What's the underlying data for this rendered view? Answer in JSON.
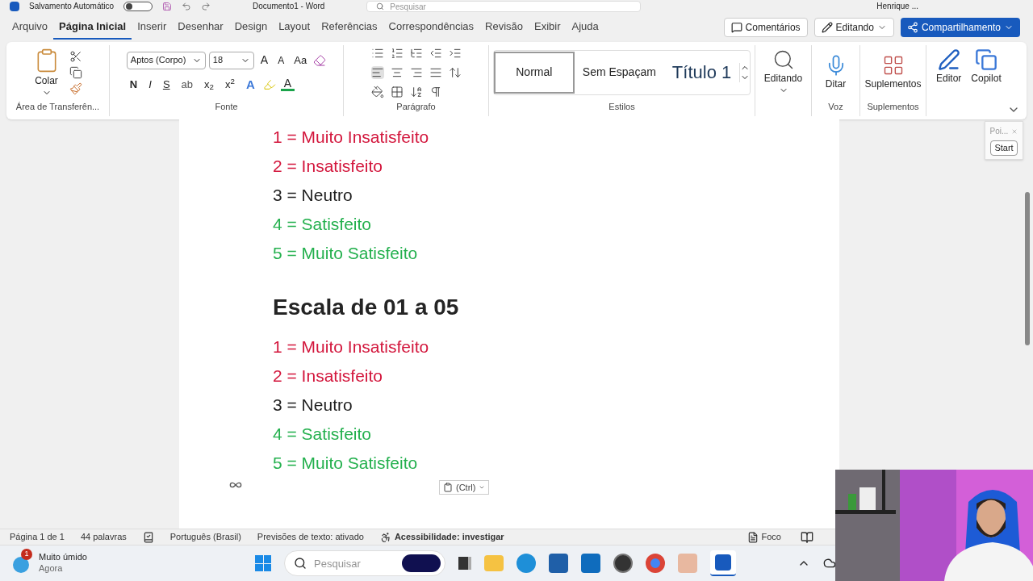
{
  "title_bar": {
    "autosave_label": "Salvamento Automático",
    "autosave_on": false,
    "document_title": "Documento1 - Word",
    "search_placeholder": "Pesquisar",
    "user_name": "Henrique ..."
  },
  "menu_tabs": [
    {
      "label": "Arquivo",
      "selected": false
    },
    {
      "label": "Página Inicial",
      "selected": true
    },
    {
      "label": "Inserir",
      "selected": false
    },
    {
      "label": "Desenhar",
      "selected": false
    },
    {
      "label": "Design",
      "selected": false
    },
    {
      "label": "Layout",
      "selected": false
    },
    {
      "label": "Referências",
      "selected": false
    },
    {
      "label": "Correspondências",
      "selected": false
    },
    {
      "label": "Revisão",
      "selected": false
    },
    {
      "label": "Exibir",
      "selected": false
    },
    {
      "label": "Ajuda",
      "selected": false
    }
  ],
  "header_buttons": {
    "comments": "Comentários",
    "editing": "Editando",
    "share": "Compartilhamento"
  },
  "ribbon": {
    "clipboard": {
      "paste": "Colar",
      "group": "Área de Transferên..."
    },
    "font": {
      "name": "Aptos (Corpo)",
      "size": "18",
      "grow": "A",
      "shrink": "A",
      "change_case": "Aa",
      "format_buttons": [
        "N",
        "I",
        "S",
        "ab",
        "x$_{2}$",
        "x$^{2}$"
      ],
      "text_effects": "A",
      "font_color": "A",
      "group": "Fonte"
    },
    "paragraph": {
      "group": "Parágrafo"
    },
    "styles": {
      "items": [
        {
          "label": "Normal",
          "selected": true
        },
        {
          "label": "Sem Espaçam",
          "selected": false
        },
        {
          "label": "Título 1",
          "selected": false
        }
      ],
      "group": "Estilos"
    },
    "editing": {
      "label": "Editando"
    },
    "voice": {
      "label": "Ditar",
      "group": "Voz"
    },
    "addins": {
      "label": "Suplementos",
      "group": "Suplementos"
    },
    "editor": "Editor",
    "copilot": "Copilot"
  },
  "document": {
    "blocks": [
      {
        "kind": "line",
        "text": "1 = Muito Insatisfeito",
        "color": "#d3163c"
      },
      {
        "kind": "line",
        "text": "2 = Insatisfeito",
        "color": "#d3163c"
      },
      {
        "kind": "line",
        "text": "3 = Neutro",
        "color": "#1f1f1f"
      },
      {
        "kind": "line",
        "text": "4 = Satisfeito",
        "color": "#24b04e"
      },
      {
        "kind": "line",
        "text": "5 = Muito Satisfeito",
        "color": "#24b04e"
      },
      {
        "kind": "heading",
        "text": "Escala de 01 a 05"
      },
      {
        "kind": "line",
        "text": "1 = Muito Insatisfeito",
        "color": "#d3163c"
      },
      {
        "kind": "line",
        "text": "2 = Insatisfeito",
        "color": "#d3163c"
      },
      {
        "kind": "line",
        "text": "3 = Neutro",
        "color": "#1f1f1f"
      },
      {
        "kind": "line",
        "text": "4 = Satisfeito",
        "color": "#24b04e"
      },
      {
        "kind": "line",
        "text": "5 = Muito Satisfeito",
        "color": "#24b04e"
      }
    ],
    "paste_options": "(Ctrl)"
  },
  "side_pane": {
    "title": "Poi...",
    "button": "Start"
  },
  "status_bar": {
    "page": "Página 1 de 1",
    "words": "44 palavras",
    "language": "Português (Brasil)",
    "predictions": "Previsões de texto: ativado",
    "accessibility": "Acessibilidade: investigar",
    "focus": "Foco"
  },
  "taskbar": {
    "weather": {
      "condition": "Muito úmido",
      "time": "Agora",
      "badge": "1"
    },
    "search_placeholder": "Pesquisar"
  }
}
